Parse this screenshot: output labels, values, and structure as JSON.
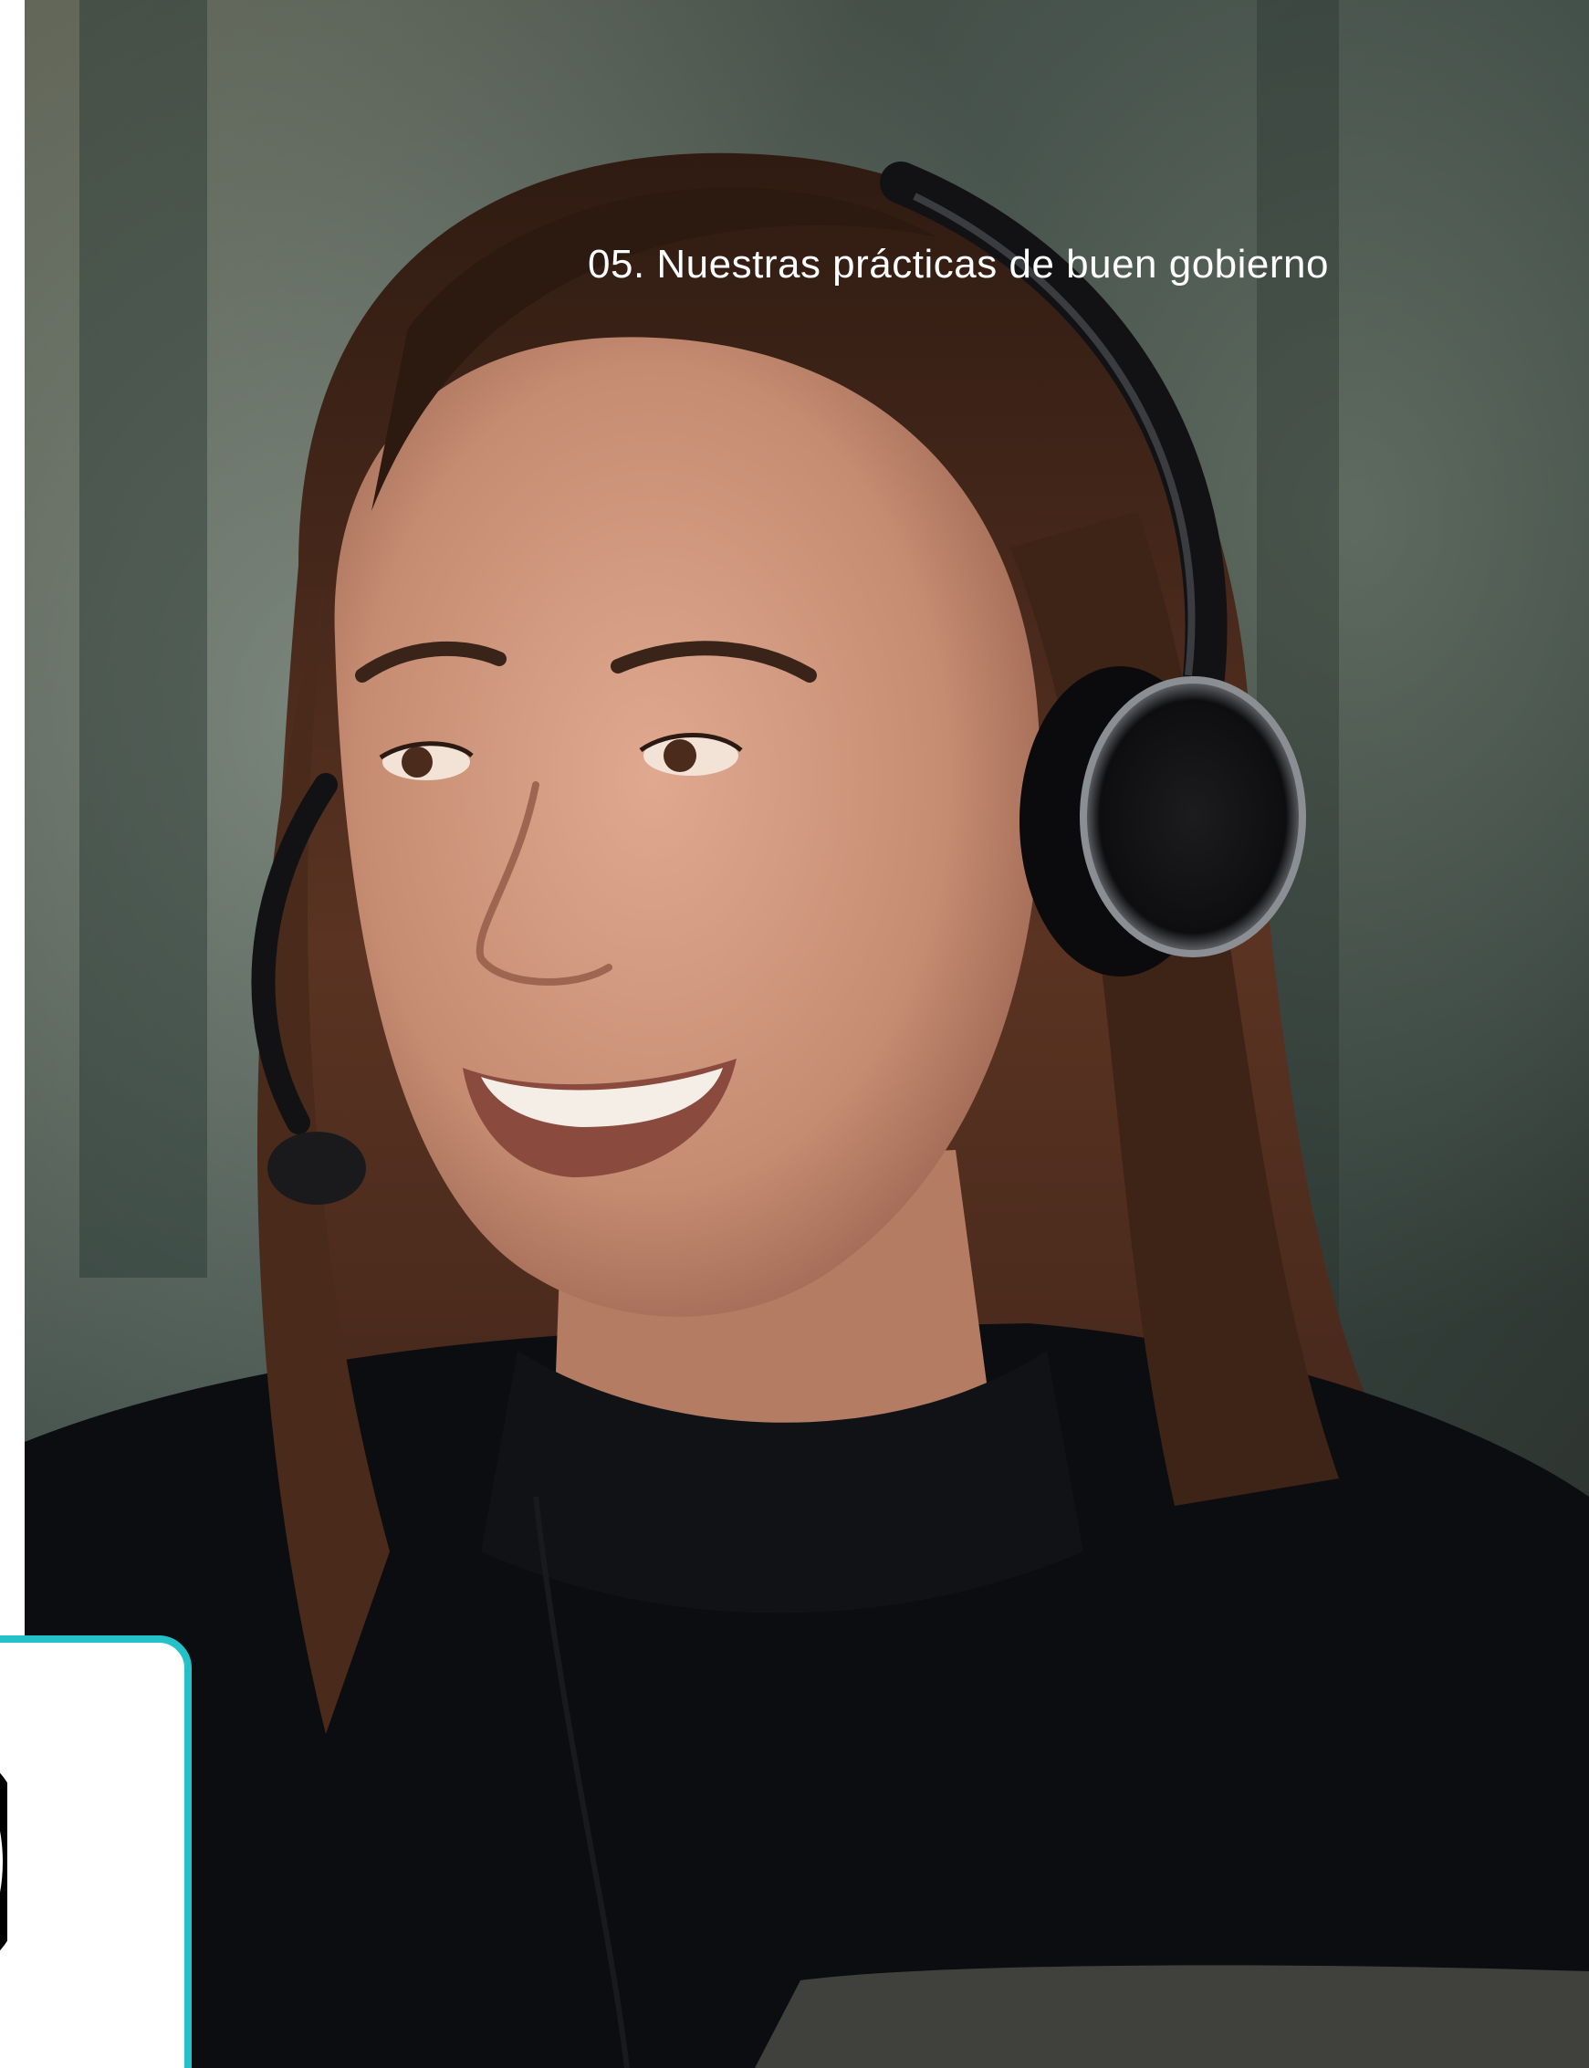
{
  "header": {
    "section_title": "05. Nuestras prácticas de buen gobierno"
  },
  "photo": {
    "subject": "woman-with-headset",
    "background_color": "#3f4741",
    "sweater_color": "#0c0d10",
    "hair_color": "#4a2a1a",
    "skin_color": "#c8917a"
  },
  "corner_card": {
    "border_color": "#23c1c8"
  }
}
